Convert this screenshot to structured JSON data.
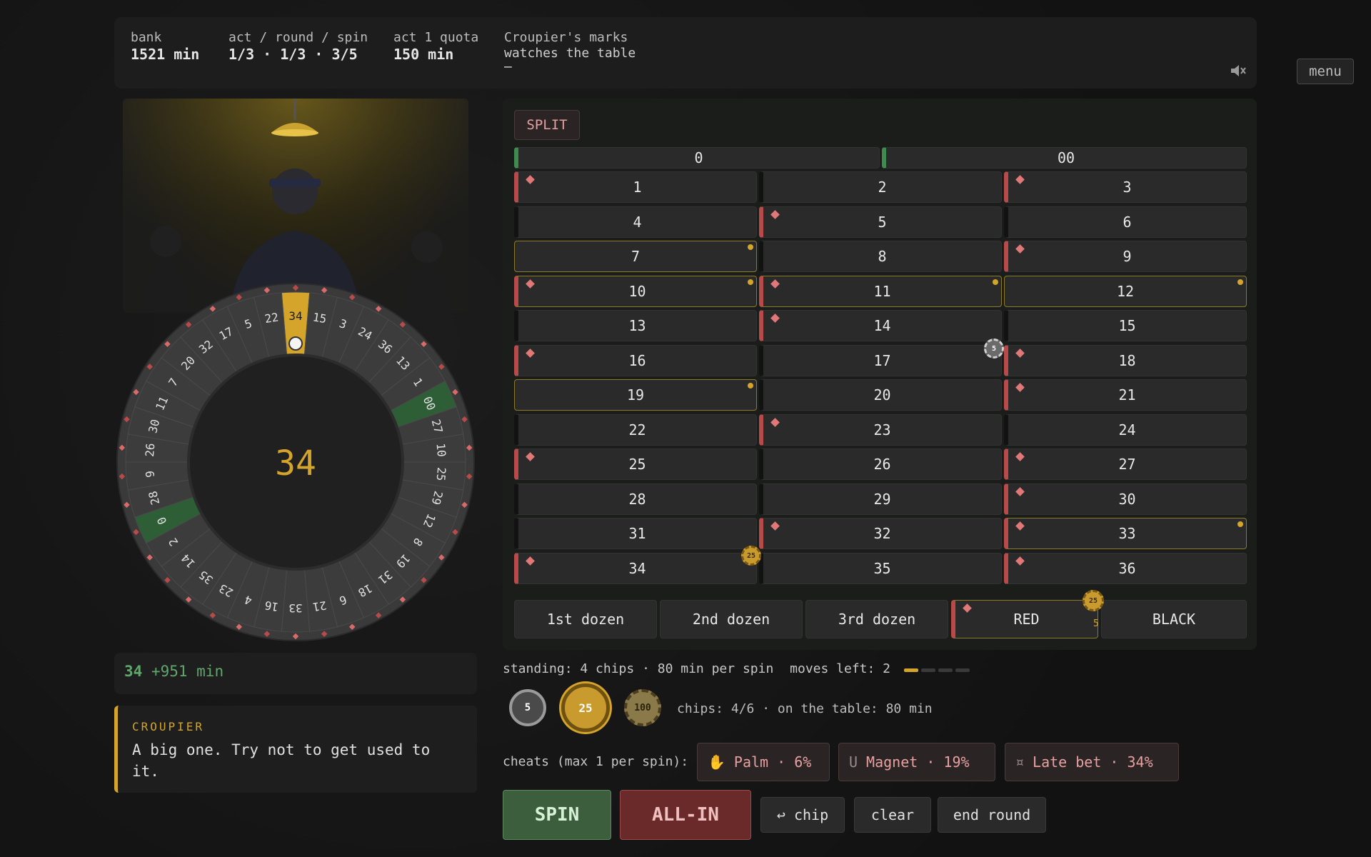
{
  "topbar": {
    "bank_label": "bank",
    "bank_value": "1521 min",
    "progress_label": "act / round / spin",
    "progress_value": "1/3 · 1/3 · 3/5",
    "quota_label": "act 1 quota",
    "quota_value": "150 min",
    "marks_label": "Croupier's marks",
    "marks_value": "watches the table",
    "marks_dash": "—",
    "sound_icon": "speaker-muted-icon",
    "menu_label": "menu"
  },
  "wheel": {
    "result": "34",
    "numbers": [
      "34",
      "15",
      "3",
      "24",
      "36",
      "13",
      "1",
      "00",
      "27",
      "10",
      "25",
      "29",
      "12",
      "8",
      "19",
      "31",
      "18",
      "6",
      "21",
      "33",
      "16",
      "4",
      "23",
      "35",
      "14",
      "2",
      "0",
      "28",
      "9",
      "26",
      "30",
      "11",
      "7",
      "20",
      "32",
      "17",
      "5",
      "22"
    ],
    "greens": [
      "0",
      "00"
    ],
    "highlight": "34"
  },
  "result": {
    "number": "34",
    "gain": "+951 min"
  },
  "croupier": {
    "name": "CROUPIER",
    "line": "A big one. Try not to get used to it."
  },
  "board": {
    "mode": "SPLIT",
    "zero": "0",
    "double_zero": "00",
    "reds": [
      1,
      3,
      5,
      9,
      10,
      11,
      14,
      16,
      18,
      21,
      23,
      25,
      27,
      30,
      32,
      33,
      34,
      36
    ],
    "hot": [
      7,
      10,
      11,
      12,
      19,
      33
    ],
    "rows": [
      [
        "1",
        "2",
        "3"
      ],
      [
        "4",
        "5",
        "6"
      ],
      [
        "7",
        "8",
        "9"
      ],
      [
        "10",
        "11",
        "12"
      ],
      [
        "13",
        "14",
        "15"
      ],
      [
        "16",
        "17",
        "18"
      ],
      [
        "19",
        "20",
        "21"
      ],
      [
        "22",
        "23",
        "24"
      ],
      [
        "25",
        "26",
        "27"
      ],
      [
        "28",
        "29",
        "30"
      ],
      [
        "31",
        "32",
        "33"
      ],
      [
        "34",
        "35",
        "36"
      ]
    ],
    "outside": [
      "1st dozen",
      "2nd dozen",
      "3rd dozen",
      "RED",
      "BLACK"
    ],
    "chips_on_board": [
      {
        "value": "5"
      },
      {
        "value": "25"
      },
      {
        "value": "25",
        "count": "5"
      }
    ]
  },
  "status": {
    "standing": "standing: 4 chips · 80 min per spin",
    "moves_left": "moves left: 2",
    "moves_total": 4,
    "moves_used": 1
  },
  "chips": {
    "denoms": [
      "5",
      "25",
      "100"
    ],
    "selected": "25",
    "info": "chips: 4/6 · on the table: 80 min"
  },
  "cheats": {
    "label": "cheats (max 1 per spin):",
    "items": [
      {
        "icon": "hand-icon",
        "label": "Palm · 6%"
      },
      {
        "icon": "magnet-icon",
        "label": "Magnet · 19%"
      },
      {
        "icon": "bug-icon",
        "label": "Late bet · 34%"
      }
    ]
  },
  "actions": {
    "spin": "SPIN",
    "allin": "ALL-IN",
    "undo": "↩ chip",
    "clear": "clear",
    "end": "end round"
  },
  "colors": {
    "gold": "#d4a52a",
    "red": "#b84a4a",
    "green": "#3f8a4f",
    "win_text": "#5fa86a"
  }
}
